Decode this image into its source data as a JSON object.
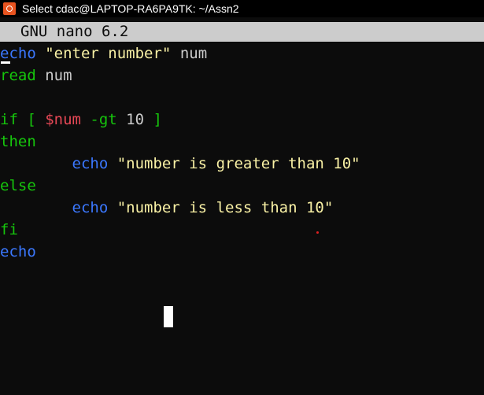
{
  "window": {
    "title": "Select cdac@LAPTOP-RA6PA9TK: ~/Assn2",
    "icon": "ubuntu-terminal-icon"
  },
  "nano": {
    "header": "GNU nano 6.2"
  },
  "editor": {
    "lines": [
      [
        {
          "t": "echo",
          "c": "kw-blue"
        },
        {
          "t": " ",
          "c": "plain"
        },
        {
          "t": "\"enter number\"",
          "c": "str"
        },
        {
          "t": " num",
          "c": "plain"
        }
      ],
      [
        {
          "t": "read",
          "c": "kw-green"
        },
        {
          "t": " num",
          "c": "plain"
        }
      ],
      [],
      [
        {
          "t": "if [ ",
          "c": "kw-green"
        },
        {
          "t": "$num",
          "c": "var"
        },
        {
          "t": " -gt",
          "c": "kw-green"
        },
        {
          "t": " 10",
          "c": "num"
        },
        {
          "t": " ]",
          "c": "kw-green"
        }
      ],
      [
        {
          "t": "then",
          "c": "kw-green"
        }
      ],
      [
        {
          "t": "        ",
          "c": "plain"
        },
        {
          "t": "echo",
          "c": "kw-blue"
        },
        {
          "t": " ",
          "c": "plain"
        },
        {
          "t": "\"number is greater than 10\"",
          "c": "str"
        }
      ],
      [
        {
          "t": "else",
          "c": "kw-green"
        }
      ],
      [
        {
          "t": "        ",
          "c": "plain"
        },
        {
          "t": "echo",
          "c": "kw-blue"
        },
        {
          "t": " ",
          "c": "plain"
        },
        {
          "t": "\"number is less than 10\"",
          "c": "str"
        }
      ],
      [
        {
          "t": "fi",
          "c": "kw-green"
        }
      ],
      [
        {
          "t": "echo",
          "c": "kw-blue"
        }
      ]
    ]
  },
  "colors": {
    "background": "#0c0c0c",
    "blue": "#3b78ff",
    "green": "#16c60c",
    "string": "#f9f1a5",
    "variable": "#e74856",
    "header_bar": "#cccccc"
  }
}
